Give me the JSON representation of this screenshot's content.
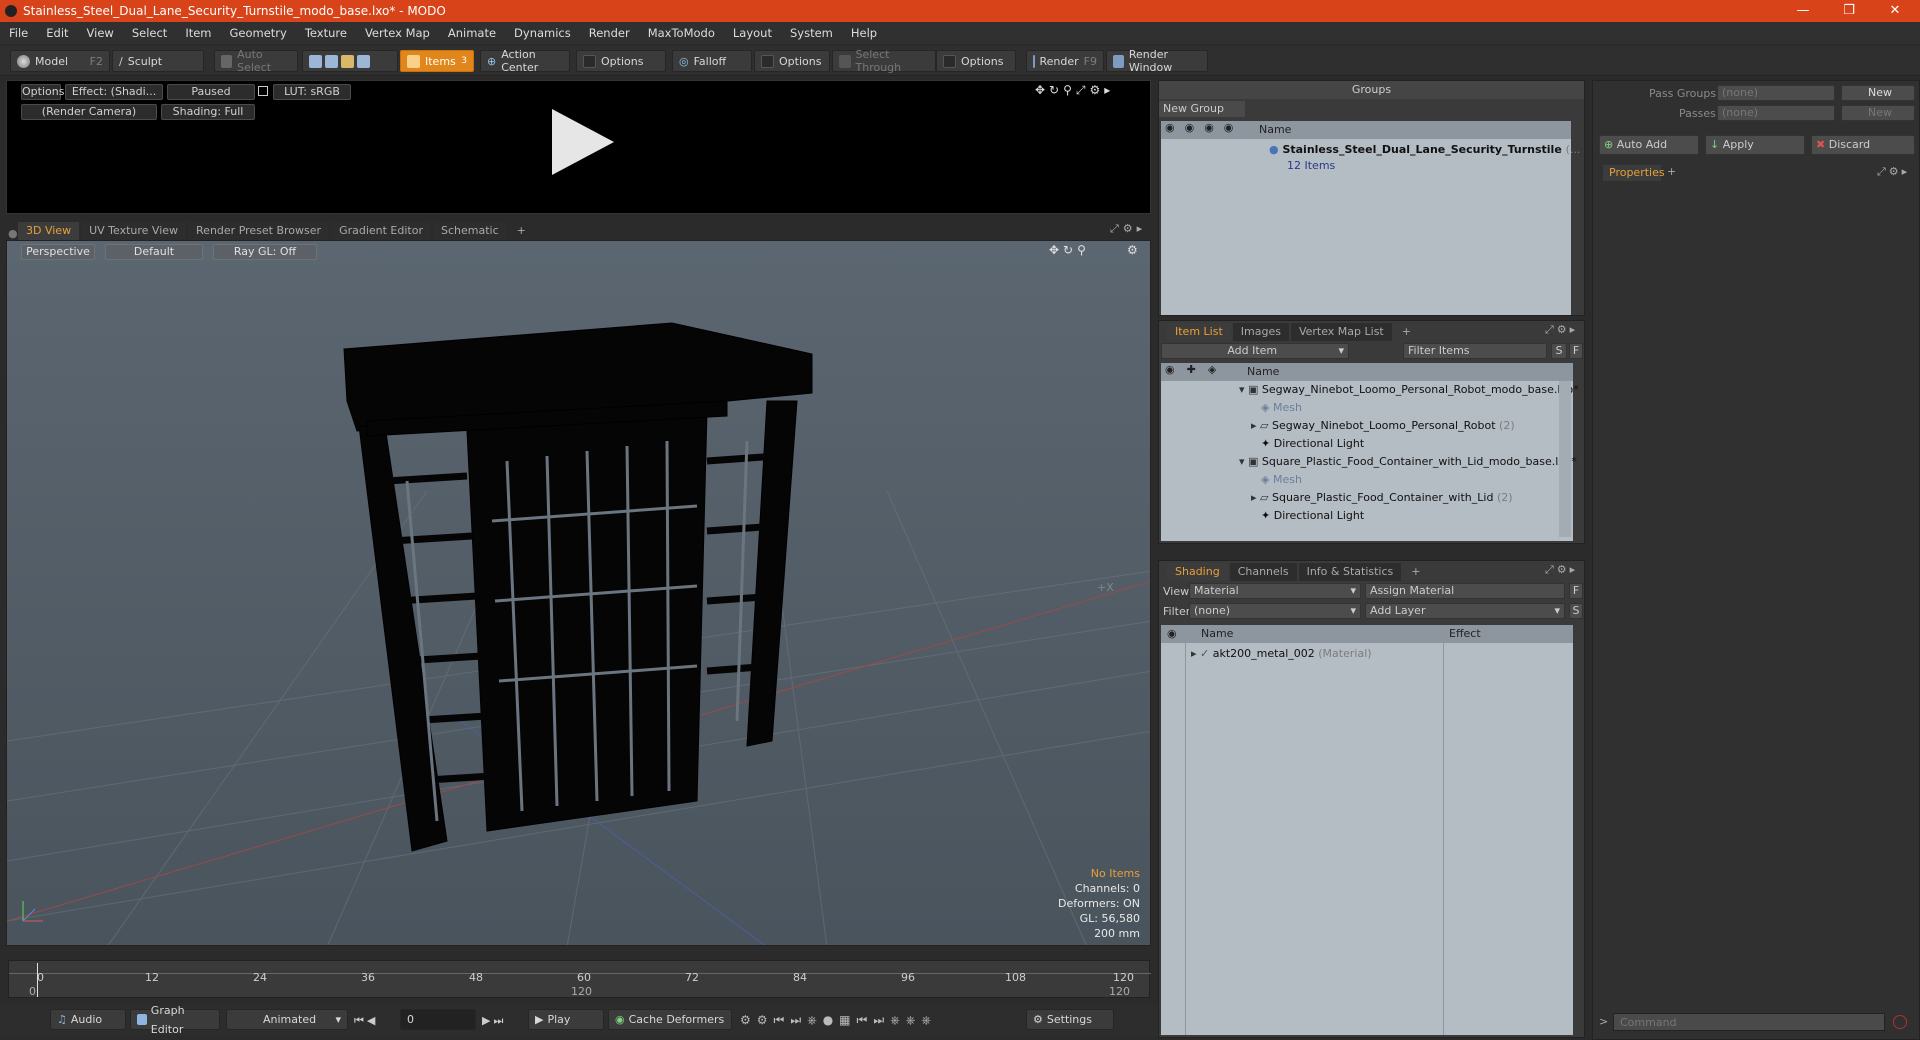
{
  "window": {
    "title": "Stainless_Steel_Dual_Lane_Security_Turnstile_modo_base.lxo* - MODO"
  },
  "menu": [
    "File",
    "Edit",
    "View",
    "Select",
    "Item",
    "Geometry",
    "Texture",
    "Vertex Map",
    "Animate",
    "Dynamics",
    "Render",
    "MaxToModo",
    "Layout",
    "System",
    "Help"
  ],
  "toolbar": {
    "model": "Model",
    "model_key": "F2",
    "sculpt": "Sculpt",
    "auto_select": "Auto Select",
    "items": "Items",
    "items_key": "3",
    "action_center": "Action Center",
    "options1": "Options",
    "falloff": "Falloff",
    "options2": "Options",
    "select_through": "Select Through",
    "options3": "Options",
    "render": "Render",
    "render_key": "F9",
    "render_window": "Render Window"
  },
  "preview": {
    "options": "Options",
    "effect": "Effect: (Shadi...",
    "paused": "Paused",
    "lut": "LUT: sRGB",
    "camera": "(Render Camera)",
    "shading": "Shading: Full"
  },
  "view_tabs": [
    "3D View",
    "UV Texture View",
    "Render Preset Browser",
    "Gradient Editor",
    "Schematic",
    "+"
  ],
  "viewport": {
    "perspective": "Perspective",
    "default": "Default",
    "raygl": "Ray GL: Off",
    "axis_hint": "+X"
  },
  "stats": {
    "no_items": "No Items",
    "channels": "Channels: 0",
    "deformers": "Deformers: ON",
    "gl": "GL: 56,580",
    "scale": "200 mm"
  },
  "timeline": {
    "ticks": [
      "0",
      "12",
      "24",
      "36",
      "48",
      "60",
      "72",
      "84",
      "96",
      "108",
      "120"
    ],
    "sub_start": "0",
    "sub_mid": "120",
    "sub_end": "120"
  },
  "bottom": {
    "audio": "Audio",
    "graph_editor": "Graph Editor",
    "animated": "Animated",
    "frame": "0",
    "play": "Play",
    "cache": "Cache Deformers",
    "settings": "Settings"
  },
  "groups": {
    "title": "Groups",
    "new_group": "New Group",
    "col_name": "Name",
    "item_name": "Stainless_Steel_Dual_Lane_Security_Turnstile",
    "item_suffix": "(...",
    "item_count": "12 Items"
  },
  "pass": {
    "pass_groups": "Pass Groups",
    "passes": "Passes",
    "none1": "(none)",
    "none2": "(none)",
    "new1": "New",
    "new2": "New",
    "auto_add": "Auto Add",
    "apply": "Apply",
    "discard": "Discard",
    "properties": "Properties",
    "plus": "+"
  },
  "itemlist": {
    "tabs": [
      "Item List",
      "Images",
      "Vertex Map List",
      "+"
    ],
    "add_item": "Add Item",
    "filter": "Filter Items",
    "s": "S",
    "f": "F",
    "col_name": "Name",
    "rows": [
      {
        "label": "Segway_Ninebot_Loomo_Personal_Robot_modo_base.lxo*",
        "extra": "",
        "kind": "scene"
      },
      {
        "label": "Mesh",
        "extra": "",
        "kind": "mesh"
      },
      {
        "label": "Segway_Ninebot_Loomo_Personal_Robot",
        "extra": "(2)",
        "kind": "group"
      },
      {
        "label": "Directional Light",
        "extra": "",
        "kind": "light"
      },
      {
        "label": "Square_Plastic_Food_Container_with_Lid_modo_base.lxo*",
        "extra": "",
        "kind": "scene"
      },
      {
        "label": "Mesh",
        "extra": "",
        "kind": "mesh"
      },
      {
        "label": "Square_Plastic_Food_Container_with_Lid",
        "extra": "(2)",
        "kind": "group"
      },
      {
        "label": "Directional Light",
        "extra": "",
        "kind": "light"
      }
    ]
  },
  "shading": {
    "tabs": [
      "Shading",
      "Channels",
      "Info & Statistics",
      "+"
    ],
    "view_label": "View",
    "view_value": "Material",
    "assign": "Assign Material",
    "f": "F",
    "filter_label": "Filter",
    "filter_value": "(none)",
    "add_layer": "Add Layer",
    "s": "S",
    "col_name": "Name",
    "col_effect": "Effect",
    "material": "akt200_metal_002",
    "material_type": "(Material)"
  },
  "command": {
    "placeholder": "Command",
    "prompt": ">"
  }
}
